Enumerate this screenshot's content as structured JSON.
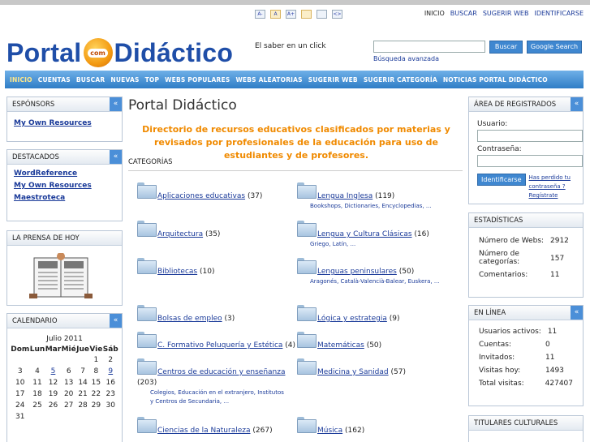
{
  "toolbar": [
    "A-",
    "A",
    "A+",
    "",
    "",
    "<>"
  ],
  "toplinks": [
    "INICIO",
    "BUSCAR",
    "SUGERIR WEB",
    "IDENTIFICARSE"
  ],
  "logo": {
    "left": "Portal",
    "ball": "com",
    "right": "Didáctico"
  },
  "slogan": "El saber en un click",
  "search": {
    "value": "",
    "button": "Buscar",
    "google": "Google Search",
    "advanced": "Búsqueda avanzada"
  },
  "nav": [
    "INICIO",
    "CUENTAS",
    "BUSCAR",
    "NUEVAS",
    "TOP",
    "WEBS POPULARES",
    "WEBS ALEATORIAS",
    "SUGERIR WEB",
    "SUGERIR CATEGORÍA",
    "NOTICIAS PORTAL DIDÁCTICO"
  ],
  "left": {
    "sponsors": {
      "title": "ESPÓNSORS",
      "links": [
        "My Own Resources"
      ]
    },
    "featured": {
      "title": "DESTACADOS",
      "links": [
        "WordReference",
        "My Own Resources",
        "Maestroteca"
      ]
    },
    "press": {
      "title": "LA PRENSA DE HOY"
    },
    "calendar": {
      "title": "CALENDARIO",
      "month": "Julio 2011",
      "days": [
        "Dom",
        "Lun",
        "Mar",
        "Mié",
        "Jue",
        "Vie",
        "Sáb"
      ],
      "weeks": [
        [
          "",
          "",
          "",
          "",
          "",
          "1",
          "2"
        ],
        [
          "3",
          "4",
          "5",
          "6",
          "7",
          "8",
          "9"
        ],
        [
          "10",
          "11",
          "12",
          "13",
          "14",
          "15",
          "16"
        ],
        [
          "17",
          "18",
          "19",
          "20",
          "21",
          "22",
          "23"
        ],
        [
          "24",
          "25",
          "26",
          "27",
          "28",
          "29",
          "30"
        ],
        [
          "31",
          "",
          "",
          "",
          "",
          "",
          ""
        ]
      ]
    }
  },
  "main": {
    "title": "Portal Didáctico",
    "intro": "Directorio de recursos educativos clasificados por materias y revisados por profesionales de la educación para uso de estudiantes y de profesores.",
    "categories_label": "CATEGORÍAS",
    "categories": [
      {
        "name": "Aplicaciones educativas",
        "count": "(37)",
        "sub": ""
      },
      {
        "name": "Lengua Inglesa",
        "count": "(119)",
        "sub": "Bookshops, Dictionaries, Encyclopedias, ..."
      },
      {
        "name": "Arquitectura",
        "count": "(35)",
        "sub": ""
      },
      {
        "name": "Lengua y Cultura Clásicas",
        "count": "(16)",
        "sub": "Griego, Latín, ..."
      },
      {
        "name": "Bibliotecas",
        "count": "(10)",
        "sub": ""
      },
      {
        "name": "Lenguas peninsulares",
        "count": "(50)",
        "sub": "Aragonés, Català-Valencià-Balear, Euskera, ..."
      },
      {
        "name": "Bolsas de empleo",
        "count": "(3)",
        "sub": ""
      },
      {
        "name": "Lógica y estrategia",
        "count": "(9)",
        "sub": ""
      },
      {
        "name": "C. Formativo Peluquería y Estética",
        "count": "(4)",
        "sub": ""
      },
      {
        "name": "Matemáticas",
        "count": "(50)",
        "sub": ""
      },
      {
        "name": "Centros de educación y enseñanza",
        "count": "(203)",
        "sub": "Colegios, Educación en el extranjero, Institutos y Centros de Secundaria, ..."
      },
      {
        "name": "Medicina y Sanidad",
        "count": "(57)",
        "sub": ""
      },
      {
        "name": "Ciencias de la Naturaleza",
        "count": "(267)",
        "sub": ""
      },
      {
        "name": "Música",
        "count": "(162)",
        "sub": ""
      }
    ]
  },
  "right": {
    "login": {
      "title": "ÁREA DE REGISTRADOS",
      "user_label": "Usuario:",
      "pass_label": "Contraseña:",
      "button": "Identificarse",
      "lost": "Has perdido tu contraseña ?",
      "register": "Regístrate"
    },
    "stats": {
      "title": "ESTADÍSTICAS",
      "rows": [
        [
          "Número de Webs:",
          "2912"
        ],
        [
          "Número de categorías:",
          "157"
        ],
        [
          "Comentarios:",
          "11"
        ]
      ]
    },
    "online": {
      "title": "EN LÍNEA",
      "rows": [
        [
          "Usuarios activos:",
          "11"
        ],
        [
          "Cuentas:",
          "0"
        ],
        [
          "Invitados:",
          "11"
        ],
        [
          "Visitas hoy:",
          "1493"
        ],
        [
          "Total visitas:",
          "427407"
        ]
      ]
    },
    "culture": {
      "title": "TITULARES CULTURALES"
    }
  }
}
